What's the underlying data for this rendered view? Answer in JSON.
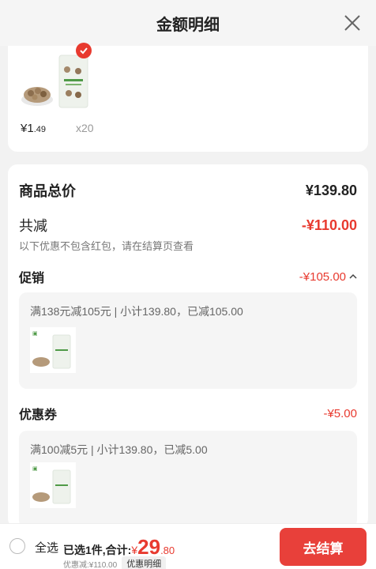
{
  "header": {
    "title": "金额明细"
  },
  "item": {
    "price_int": "¥1",
    "price_dec": ".49",
    "qty": "x20"
  },
  "summary": {
    "total_label": "商品总价",
    "total_value": "¥139.80",
    "reduce_label": "共减",
    "reduce_value": "-¥110.00",
    "note": "以下优惠不包含红包，请在结算页查看"
  },
  "promo": {
    "label": "促销",
    "value": "-¥105.00",
    "detail": "满138元减105元 | 小计139.80，已减105.00"
  },
  "coupon": {
    "label": "优惠券",
    "value": "-¥5.00",
    "detail": "满100减5元 | 小计139.80，已减5.00"
  },
  "bottom": {
    "select_all": "全选",
    "sum_label": "已选1件,合计:",
    "currency": "¥",
    "amount_int": "29",
    "amount_dec": ".80",
    "discount": "优惠减:¥110.00",
    "detail_tag": "优惠明细",
    "checkout": "去结算"
  },
  "colors": {
    "accent": "#e83a2f"
  }
}
